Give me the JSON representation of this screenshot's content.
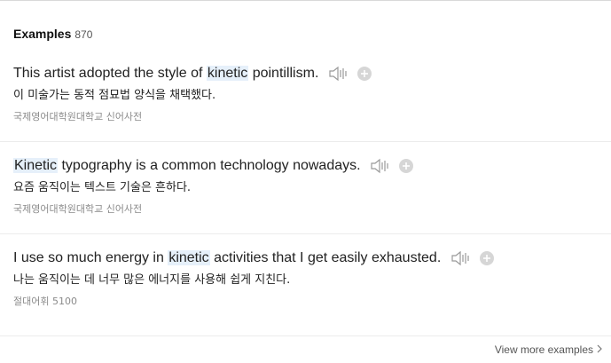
{
  "examples_section": {
    "title": "Examples",
    "count": "870",
    "view_more_label": "View more examples"
  },
  "examples": [
    {
      "pre": "This artist adopted the style of ",
      "highlight": "kinetic",
      "post": " pointillism.",
      "translation": "이 미술가는 동적 점묘법 양식을 채택했다.",
      "source": "국제영어대학원대학교 신어사전"
    },
    {
      "pre": "",
      "highlight": "Kinetic",
      "post": " typography is a common technology nowadays.",
      "translation": "요즘 움직이는 텍스트 기술은 흔하다.",
      "source": "국제영어대학원대학교 신어사전"
    },
    {
      "pre": "I use so much energy in ",
      "highlight": "kinetic",
      "post": " activities that I get easily exhausted.",
      "translation": "나는 움직이는 데 너무 많은 에너지를 사용해 쉽게 지친다.",
      "source": "절대어휘 5100"
    }
  ],
  "icons": {
    "speaker": "speaker-icon",
    "add": "plus-circle-icon",
    "chevron": "chevron-right-icon"
  },
  "colors": {
    "highlight_bg": "#e6f0fa",
    "icon_gray": "#999999",
    "source_gray": "#8b8b8b"
  }
}
